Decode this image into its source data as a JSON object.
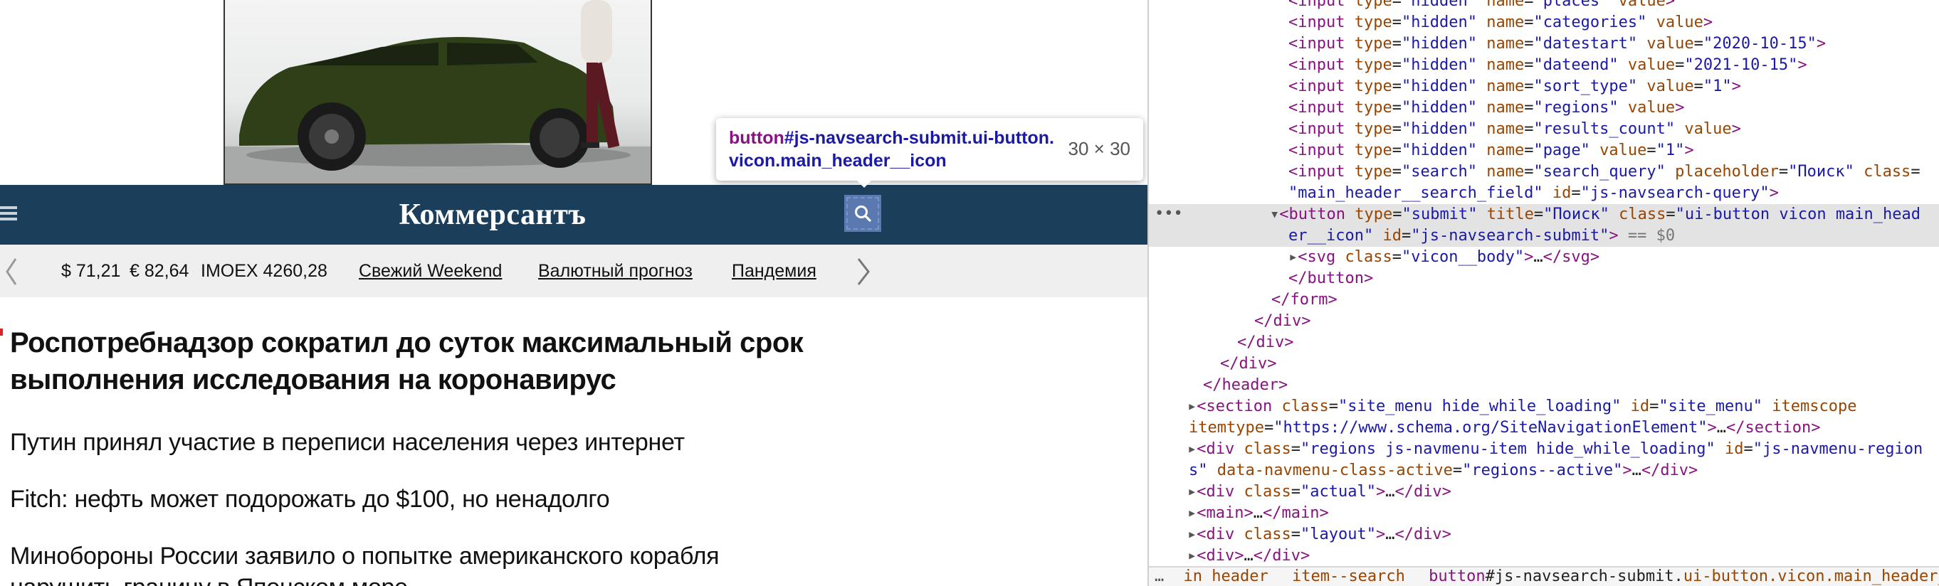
{
  "page": {
    "logo": "Коммерсантъ",
    "ticker": {
      "usd": "$ 71,21",
      "eur": "€ 82,64",
      "imoex": "IMOEX 4260,28",
      "links": [
        "Свежий Weekend",
        "Валютный прогноз",
        "Пандемия"
      ]
    },
    "headlines": {
      "main_line1": "Роспотребнадзор сократил до суток максимальный срок",
      "main_line2": "выполнения исследования на коронавирус",
      "items": [
        "Путин принял участие в переписи населения через интернет",
        "Fitch: нефть может подорожать до $100, но ненадолго",
        "Минобороны России заявило о попытке американского корабля",
        "нарушить границу в Японском море"
      ]
    }
  },
  "tooltip": {
    "tag": "button",
    "selector": "#js-navsearch-submit.ui-button.vicon.main_header__icon",
    "size": "30 × 30"
  },
  "devtools": {
    "inputs": [
      {
        "type": "hidden",
        "name": "places",
        "value": ""
      },
      {
        "type": "hidden",
        "name": "categories",
        "value": ""
      },
      {
        "type": "hidden",
        "name": "datestart",
        "value": "2020-10-15"
      },
      {
        "type": "hidden",
        "name": "dateend",
        "value": "2021-10-15"
      },
      {
        "type": "hidden",
        "name": "sort_type",
        "value": "1"
      },
      {
        "type": "hidden",
        "name": "regions",
        "value": ""
      },
      {
        "type": "hidden",
        "name": "results_count",
        "value": ""
      },
      {
        "type": "hidden",
        "name": "page",
        "value": "1"
      }
    ],
    "search_input": {
      "type": "search",
      "name": "search_query",
      "placeholder": "Поиск",
      "class": "main_header__search_field",
      "id": "js-navsearch-query"
    },
    "selected_button": {
      "type": "submit",
      "title": "Поиск",
      "class_part1": "ui-button vicon main_head",
      "class_part2": "er__icon",
      "id": "js-navsearch-submit",
      "marker": "== $0"
    },
    "svg_child": {
      "class": "vicon__body",
      "ellipsis": "…"
    },
    "closing": [
      "</button>",
      "</form>",
      "</div>",
      "</div>",
      "</div>",
      "</header>"
    ],
    "section": {
      "class": "site_menu hide_while_loading",
      "id": "site_menu",
      "itemscope": "itemscope",
      "itemtype": "https://www.schema.org/SiteNavigationElement"
    },
    "regions_div": {
      "class": "regions js-navmenu-item hide_while_loading",
      "id_part1": "js-navmenu-region",
      "id_part2": "s",
      "data_attr": "data-navmenu-class-active",
      "data_val": "regions--active"
    },
    "actual_div_class": "actual",
    "layout_div_class": "layout",
    "breadcrumbs": {
      "c1": "in header",
      "c2": "item--search",
      "c3_tag": "button",
      "c3_rest": "#js-navsearch-submit.",
      "c3_cls": "ui-button.vicon.main_header__icon"
    }
  }
}
